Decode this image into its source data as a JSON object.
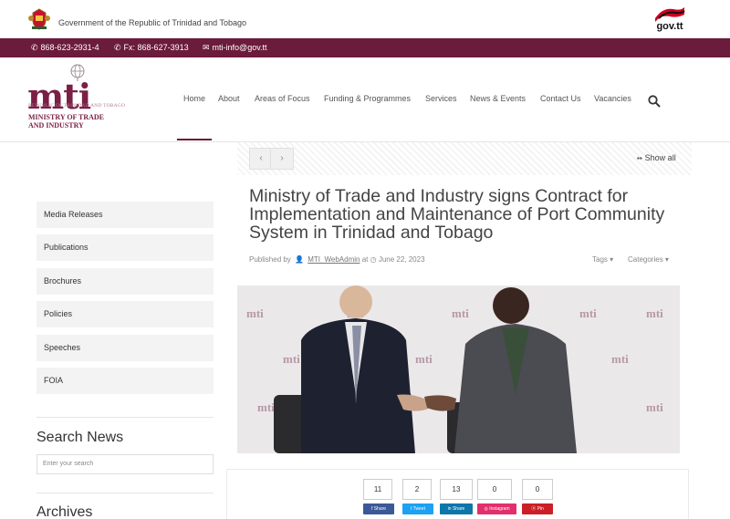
{
  "gov_bar": {
    "title": "Government of the Republic of Trinidad and Tobago",
    "govtt_logo": "gov.tt"
  },
  "contact": {
    "phone": "868-623-2931-4",
    "fax": "Fx: 868-627-3913",
    "email": "mti-info@gov.tt"
  },
  "logo": {
    "mark": "mti",
    "republic": "REPUBLIC OF TRINIDAD AND TOBAGO",
    "ministry_line1": "MINISTRY OF TRADE",
    "ministry_line2": "AND INDUSTRY"
  },
  "nav": {
    "items": [
      "Home",
      "About",
      "Areas of Focus",
      "Funding & Programmes",
      "Services",
      "News & Events",
      "Contact Us",
      "Vacancies"
    ],
    "active": "Home"
  },
  "pager": {
    "prev": "‹",
    "next": "›",
    "show_all": "Show all"
  },
  "sidebar": {
    "items": [
      "Media Releases",
      "Publications",
      "Brochures",
      "Policies",
      "Speeches",
      "FOIA"
    ],
    "search_heading": "Search News",
    "search_placeholder": "Enter your search",
    "archives_heading": "Archives"
  },
  "article": {
    "title": "Ministry of Trade and Industry signs Contract for Implementation and Maintenance of Port Community System in Trinidad and Tobago",
    "published_by": "Published by",
    "author": "MTI_WebAdmin",
    "at": "at",
    "date": "June 22, 2023",
    "tags": "Tags",
    "categories": "Categories",
    "photo_watermark": "mti"
  },
  "social": {
    "counts": [
      "11",
      "2",
      "13",
      "0",
      "0"
    ],
    "buttons": [
      "Share",
      "Tweet",
      "Share",
      "Instagram",
      "Pin"
    ],
    "colors": {
      "facebook": "#3b5998",
      "twitter": "#1da1f2",
      "linkedin": "#0e76a8",
      "instagram": "#e1306c",
      "pinterest": "#cb2027"
    }
  },
  "colors": {
    "brand": "#6b1b3b",
    "logo": "#7a1f45"
  }
}
